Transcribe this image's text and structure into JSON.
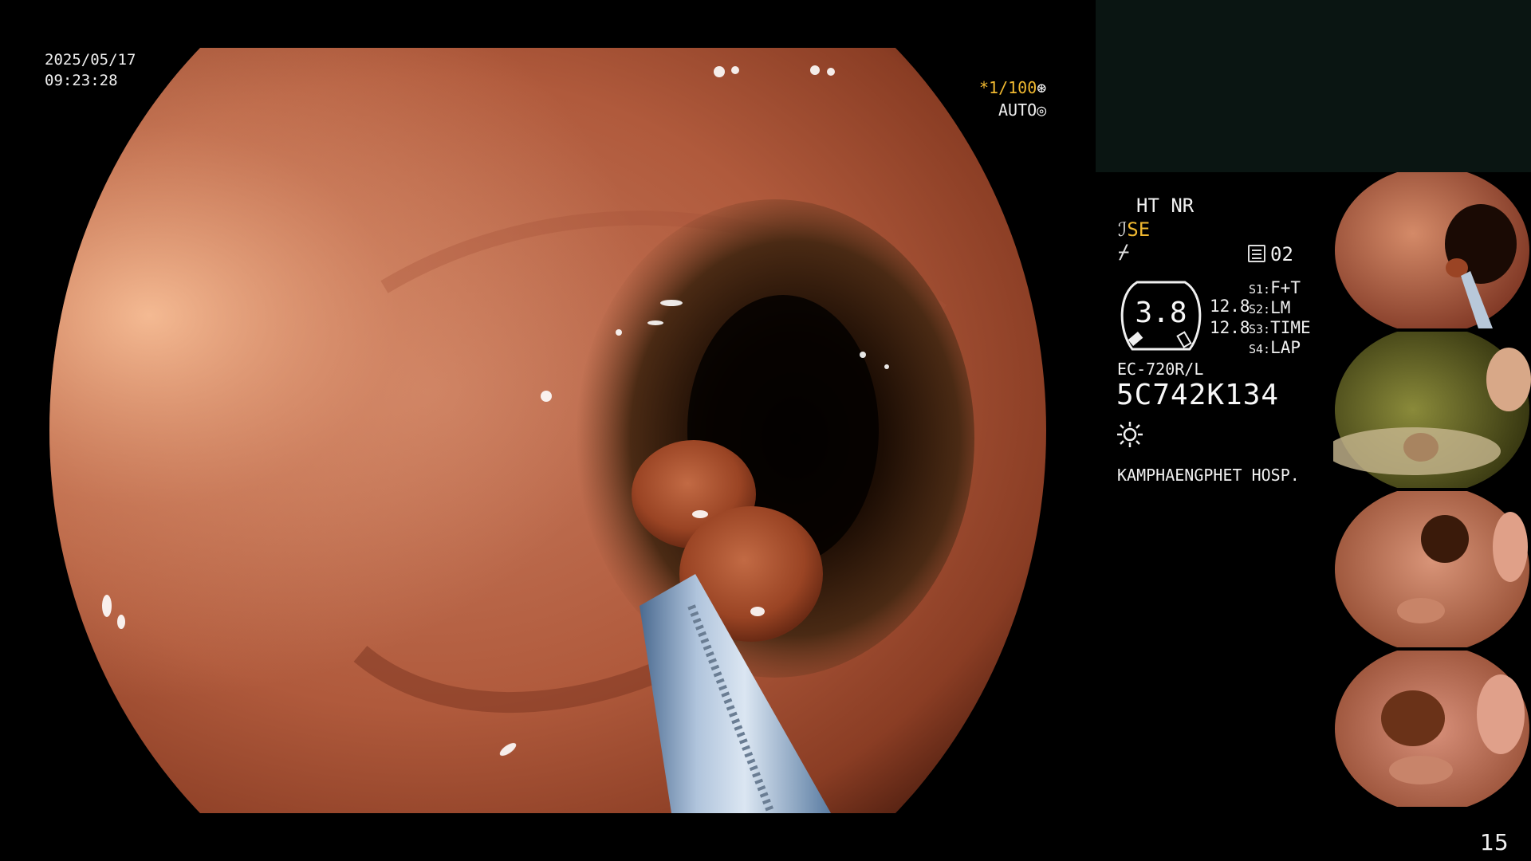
{
  "timestamp": {
    "date": "2025/05/17",
    "time": "09:23:28"
  },
  "capture": {
    "shutter_value": "*1/100",
    "shutter_icon": "shutter-icon",
    "auto_value": "AUTO",
    "auto_icon": "iris-icon"
  },
  "settings": {
    "ht_nr": "HT NR",
    "enhance_glyph": "ℐ",
    "se_value": "SE",
    "filter_glyph": "⌿",
    "memory_value": "02",
    "gauge_value": "3.8",
    "gauge_top": "12.8",
    "gauge_bottom": "12.8",
    "switches": [
      {
        "key": "S1:",
        "value": "F+T"
      },
      {
        "key": "S2:",
        "value": "LM"
      },
      {
        "key": "S3:",
        "value": "TIME"
      },
      {
        "key": "S4:",
        "value": "LAP"
      }
    ]
  },
  "scope": {
    "model": "EC-720R/L",
    "serial": "5C742K134"
  },
  "light_icon": "light-source-icon",
  "hospital": "KAMPHAENGPHET HOSP.",
  "thumbnails": [
    {
      "tone": "#b86a48"
    },
    {
      "tone": "#6a6a2a"
    },
    {
      "tone": "#c07d62"
    },
    {
      "tone": "#c47c5c"
    }
  ],
  "page_number": "15"
}
